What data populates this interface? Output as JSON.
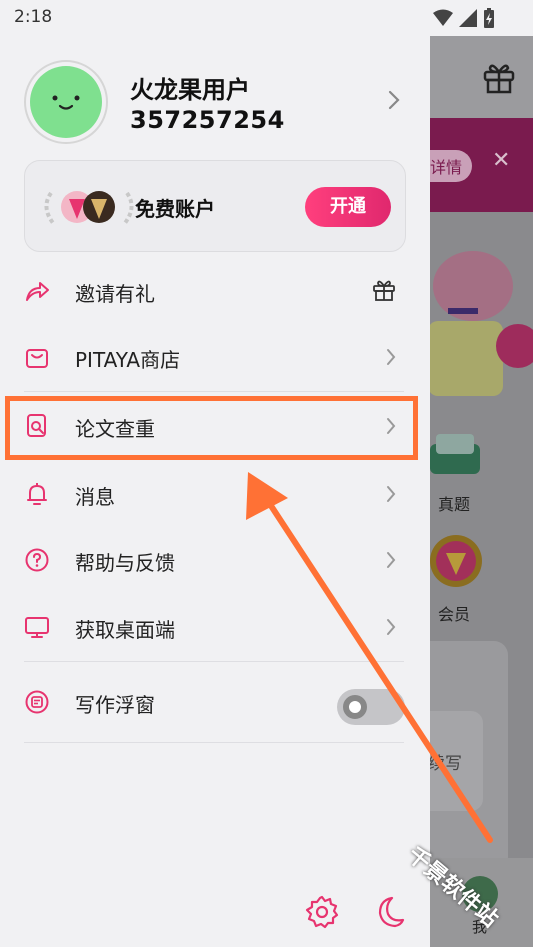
{
  "status_bar": {
    "time": "2:18"
  },
  "profile": {
    "name": "火龙果用户",
    "user_id": "357257254"
  },
  "account": {
    "label": "免费账户",
    "activate_label": "开通"
  },
  "menu": [
    {
      "label": "邀请有礼",
      "icon": "share-icon",
      "trailing": "gift-icon"
    },
    {
      "label": "PITAYA商店",
      "icon": "shopping-bag-icon",
      "trailing": "chevron-right-icon"
    },
    {
      "label": "论文查重",
      "icon": "document-search-icon",
      "trailing": "chevron-right-icon"
    },
    {
      "label": "消息",
      "icon": "bell-icon",
      "trailing": "chevron-right-icon"
    },
    {
      "label": "帮助与反馈",
      "icon": "help-circle-icon",
      "trailing": "chevron-right-icon"
    },
    {
      "label": "获取桌面端",
      "icon": "monitor-icon",
      "trailing": "chevron-right-icon"
    },
    {
      "label": "写作浮窗",
      "icon": "floating-window-icon",
      "trailing": "toggle",
      "toggle_on": false
    }
  ],
  "footer": {
    "left_icon": "settings-icon",
    "right_icon": "moon-icon"
  },
  "background_app": {
    "banner_button": "详情",
    "item_labels": [
      "真题",
      "会员"
    ],
    "card_label": "续写",
    "tab_label": "我"
  },
  "watermark": "千景软件站",
  "colors": {
    "accent": "#e7346f",
    "highlight": "#ff7135",
    "avatar": "#7fe08f"
  }
}
